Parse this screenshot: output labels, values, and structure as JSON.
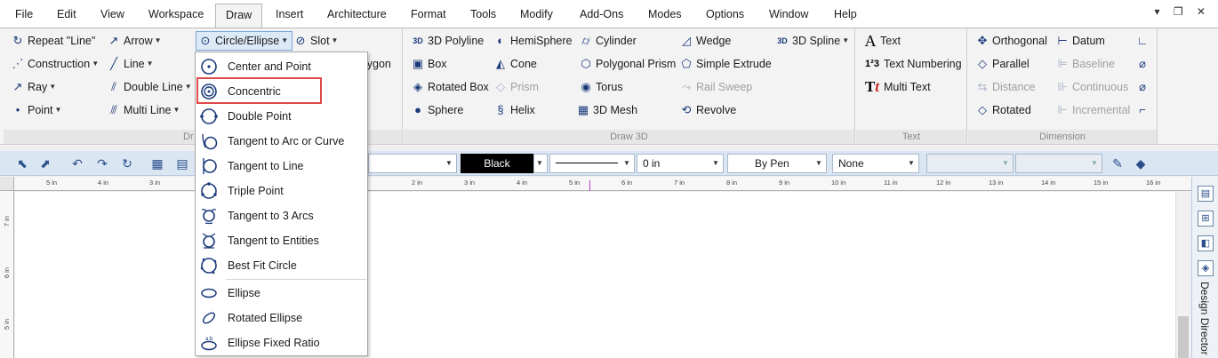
{
  "menubar": {
    "items": [
      "File",
      "Edit",
      "View",
      "Workspace",
      "Draw",
      "Insert",
      "Architecture",
      "Format",
      "Tools",
      "Modify",
      "Add-Ons",
      "Modes",
      "Options",
      "Window",
      "Help"
    ],
    "active": "Draw",
    "window_controls": "▾ ❐ ✕"
  },
  "ribbon": {
    "draw2d": {
      "repeat_line": "Repeat \"Line\"",
      "construction": "Construction",
      "ray": "Ray",
      "point": "Point",
      "arrow": "Arrow",
      "line": "Line",
      "double_line": "Double Line",
      "multi_line": "Multi Line",
      "circle_ellipse": "Circle/Ellipse",
      "slot": "Slot",
      "polygon_partial": "lygon",
      "group_label_partial": "Dr"
    },
    "draw3d": {
      "polyline": "3D Polyline",
      "box": "Box",
      "rotated_box": "Rotated Box",
      "sphere": "Sphere",
      "hemisphere": "HemiSphere",
      "cone": "Cone",
      "prism": "Prism",
      "helix": "Helix",
      "cylinder": "Cylinder",
      "polygonal_prism": "Polygonal Prism",
      "torus": "Torus",
      "mesh": "3D Mesh",
      "wedge": "Wedge",
      "simple_extrude": "Simple Extrude",
      "rail_sweep": "Rail Sweep",
      "revolve": "Revolve",
      "spline": "3D Spline",
      "group_label": "Draw 3D"
    },
    "text": {
      "text": "Text",
      "text_numbering": "Text Numbering",
      "multi_text": "Multi Text",
      "group_label": "Text"
    },
    "dimension": {
      "orthogonal": "Orthogonal",
      "parallel": "Parallel",
      "distance": "Distance",
      "rotated": "Rotated",
      "datum": "Datum",
      "baseline": "Baseline",
      "continuous": "Continuous",
      "incremental": "Incremental",
      "group_label": "Dimension"
    }
  },
  "toolbar": {
    "color": "Black",
    "line_width": "0 in",
    "pen": "By Pen",
    "fill": "None"
  },
  "ruler": {
    "h_labels": [
      "5 in",
      "4 in",
      "3 in",
      "2 in",
      "3 in",
      "4 in",
      "5 in",
      "6 in",
      "7 in",
      "8 in",
      "9 in",
      "10 in",
      "11 in",
      "12 in",
      "13 in",
      "14 in",
      "15 in",
      "16 in"
    ],
    "v_labels": [
      "7 in",
      "6 in",
      "5 in"
    ]
  },
  "right_panel": {
    "label": "Design Director"
  },
  "circle_menu": {
    "items": [
      "Center and Point",
      "Concentric",
      "Double Point",
      "Tangent to Arc or Curve",
      "Tangent to Line",
      "Triple Point",
      "Tangent to 3 Arcs",
      "Tangent to Entities",
      "Best Fit Circle",
      "Ellipse",
      "Rotated Ellipse",
      "Ellipse Fixed Ratio"
    ],
    "highlighted": "Concentric"
  },
  "colors": {
    "accent_blue": "#1b3a7a",
    "highlight_red": "#e0484a",
    "toolbar_bg": "#dbe6f3"
  }
}
